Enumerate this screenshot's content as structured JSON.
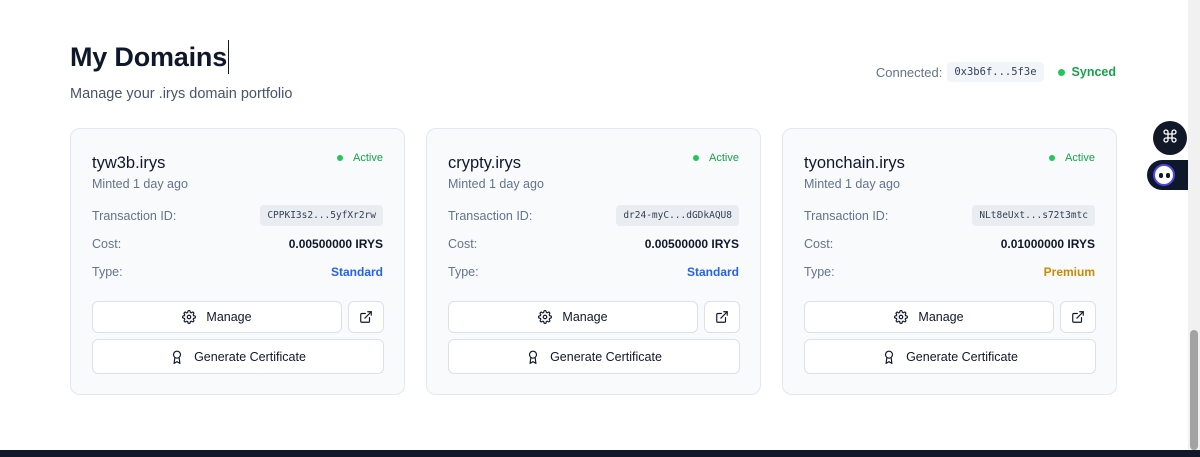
{
  "header": {
    "title": "My Domains",
    "subtitle": "Manage your .irys domain portfolio"
  },
  "wallet": {
    "connected_label": "Connected:",
    "address": "0x3b6f...5f3e",
    "sync_status": "Synced"
  },
  "labels": {
    "transaction_id": "Transaction ID:",
    "cost": "Cost:",
    "type": "Type:",
    "manage": "Manage",
    "generate_certificate": "Generate Certificate"
  },
  "domains": [
    {
      "name": "tyw3b.irys",
      "minted": "Minted 1 day ago",
      "status": "Active",
      "transaction_id": "CPPKI3s2...5yfXr2rw",
      "cost": "0.00500000 IRYS",
      "type": "Standard"
    },
    {
      "name": "crypty.irys",
      "minted": "Minted 1 day ago",
      "status": "Active",
      "transaction_id": "dr24-myC...dGDkAQU8",
      "cost": "0.00500000 IRYS",
      "type": "Standard"
    },
    {
      "name": "tyonchain.irys",
      "minted": "Minted 1 day ago",
      "status": "Active",
      "transaction_id": "NLt8eUxt...s72t3mtc",
      "cost": "0.01000000 IRYS",
      "type": "Premium"
    }
  ],
  "colors": {
    "active": "#22c55e",
    "standard": "#2563eb",
    "premium": "#ca8a04"
  },
  "icons": {
    "manage": "gear-icon",
    "external": "external-link-icon",
    "certificate": "award-icon",
    "side_menu": "command-icon",
    "side_assistant": "ghost-icon"
  }
}
